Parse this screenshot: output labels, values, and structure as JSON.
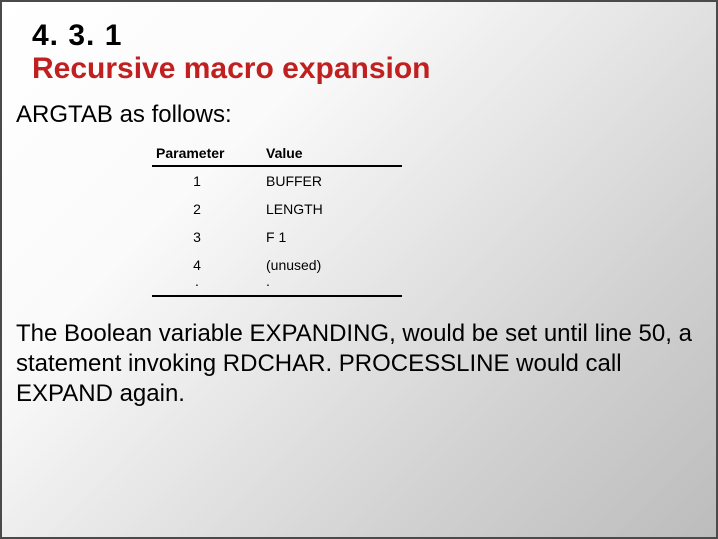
{
  "header": {
    "section_number": "4. 3. 1",
    "section_title": "Recursive macro expansion"
  },
  "lead": "ARGTAB as follows:",
  "table": {
    "headers": {
      "param": "Parameter",
      "value": "Value"
    },
    "rows": [
      {
        "param": "1",
        "value": "BUFFER"
      },
      {
        "param": "2",
        "value": "LENGTH"
      },
      {
        "param": "3",
        "value": "F 1"
      },
      {
        "param": "4",
        "value": "(unused)"
      },
      {
        "param": ".",
        "value": "."
      }
    ]
  },
  "body": "The Boolean variable EXPANDING, would be set until line 50, a statement invoking RDCHAR. PROCESSLINE would call EXPAND again.",
  "chart_data": {
    "type": "table",
    "title": "ARGTAB",
    "columns": [
      "Parameter",
      "Value"
    ],
    "rows": [
      [
        "1",
        "BUFFER"
      ],
      [
        "2",
        "LENGTH"
      ],
      [
        "3",
        "F 1"
      ],
      [
        "4",
        "(unused)"
      ],
      [
        ".",
        "."
      ]
    ]
  }
}
